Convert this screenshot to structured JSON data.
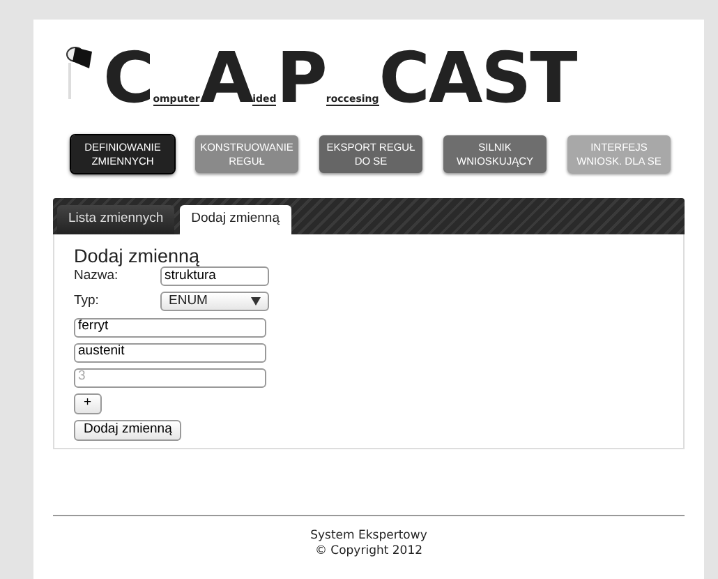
{
  "logo": [
    {
      "text": "C",
      "kind": "big"
    },
    {
      "text": "omputer",
      "kind": "small"
    },
    {
      "text": "A",
      "kind": "big"
    },
    {
      "text": "ided",
      "kind": "small"
    },
    {
      "text": "P",
      "kind": "big"
    },
    {
      "text": "roccesing",
      "kind": "small"
    },
    {
      "text": "CAST",
      "kind": "big"
    }
  ],
  "nav": [
    {
      "label": "DEFINIOWANIE ZMIENNYCH",
      "selected": true,
      "color": "#222222"
    },
    {
      "label": "KONSTRUOWANIE REGUŁ",
      "selected": false,
      "color": "#8a8a8a"
    },
    {
      "label": "EKSPORT REGUŁ DO SE",
      "selected": false,
      "color": "#666666"
    },
    {
      "label": "SILNIK WNIOSKUJĄCY",
      "selected": false,
      "color": "#6e6e6e"
    },
    {
      "label": "INTERFEJS WNIOSK. DLA SE",
      "selected": false,
      "color": "#a8a8a8"
    }
  ],
  "tabs": [
    {
      "label": "Lista zmiennych",
      "selected": false
    },
    {
      "label": "Dodaj zmienną",
      "selected": true
    }
  ],
  "form": {
    "heading": "Dodaj zmienną",
    "name_label": "Nazwa:",
    "name_value": "struktura",
    "type_label": "Typ:",
    "type_value": "ENUM",
    "values": [
      {
        "value": "ferryt"
      },
      {
        "value": "austenit"
      },
      {
        "placeholder": "3"
      }
    ],
    "add_button": "+",
    "submit_button": "Dodaj zmienną"
  },
  "footer": [
    "System Ekspertowy",
    "© Copyright 2012"
  ]
}
